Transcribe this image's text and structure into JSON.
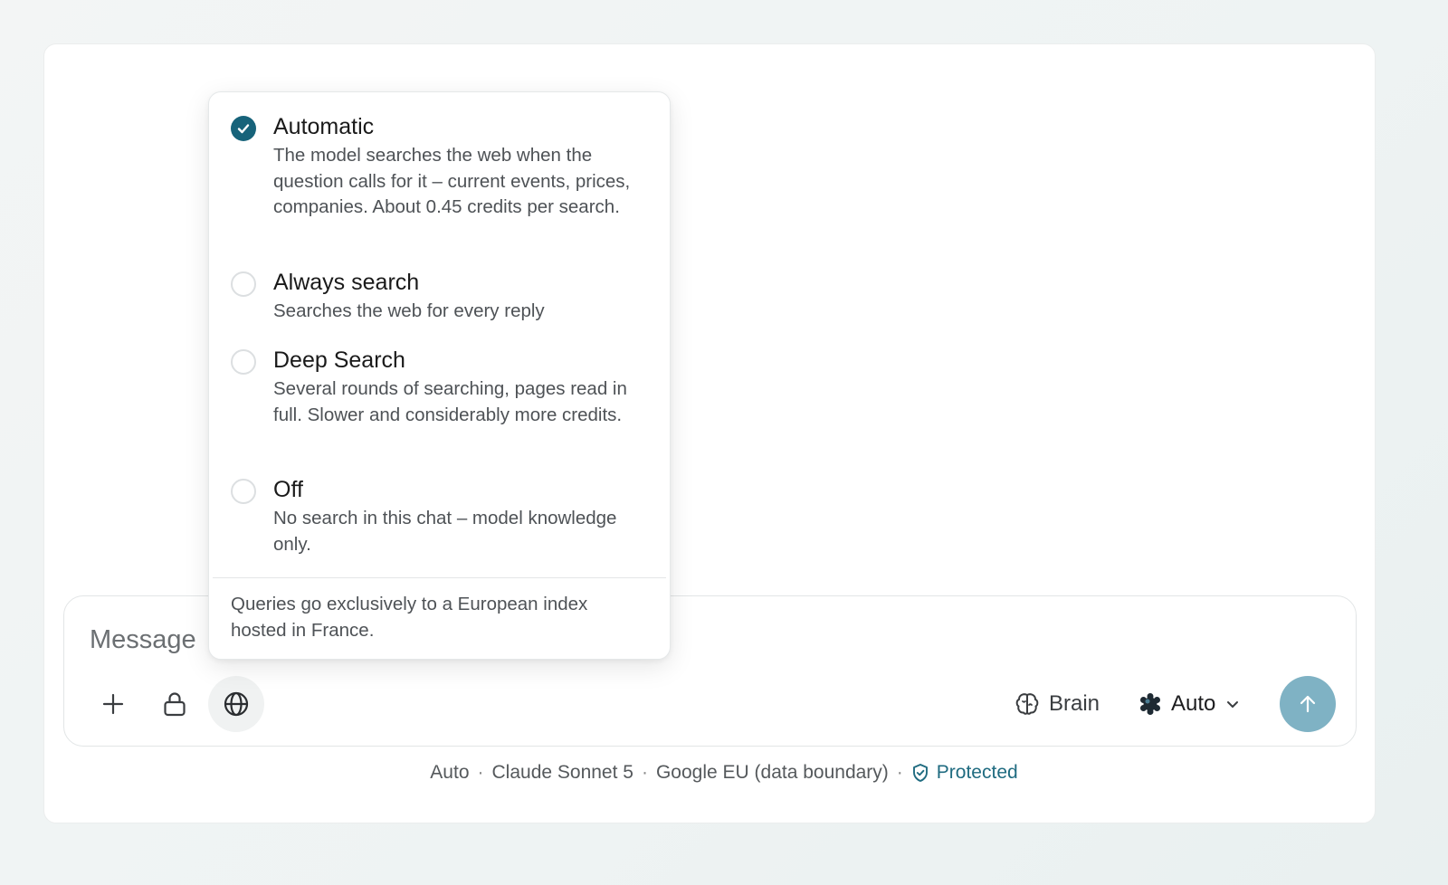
{
  "composer": {
    "placeholder": "Message",
    "brain_label": "Brain",
    "model_label": "Auto"
  },
  "search_menu": {
    "options": [
      {
        "title": "Automatic",
        "description": "The model searches the web when the question calls for it – current events, prices, companies. About 0.45 credits per search.",
        "selected": true
      },
      {
        "title": "Always search",
        "description": "Searches the web for every reply",
        "selected": false
      },
      {
        "title": "Deep Search",
        "description": "Several rounds of searching, pages read in full. Slower and considerably more credits.",
        "selected": false
      },
      {
        "title": "Off",
        "description": "No search in this chat – model knowledge only.",
        "selected": false
      }
    ],
    "note": "Queries go exclusively to a European index hosted in France."
  },
  "footer": {
    "mode": "Auto",
    "model": "Claude Sonnet 5",
    "region": "Google EU (data boundary)",
    "status": "Protected",
    "separator": "·"
  },
  "colors": {
    "accent": "#17637a",
    "send_button": "#7fb2c4",
    "protected_text": "#1f6b80"
  },
  "icons": {
    "add": "plus-icon",
    "privacy": "lock-icon",
    "web_search": "globe-icon",
    "brain": "brain-icon",
    "model": "model-logo-icon",
    "dropdown": "chevron-down-icon",
    "send": "arrow-up-icon",
    "protected": "shield-check-icon",
    "selected": "check-icon"
  }
}
